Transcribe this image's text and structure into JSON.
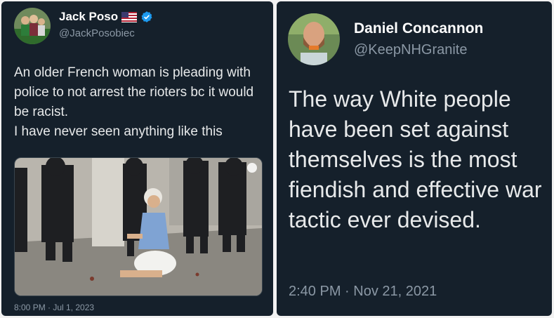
{
  "left_tweet": {
    "display_name": "Jack Poso",
    "handle": "@JackPosobiec",
    "text_lines": [
      "An older French woman is pleading with police to not arrest the rioters bc it would be racist.",
      "I have never seen anything like this"
    ],
    "timestamp": "8:00 PM · Jul 1, 2023",
    "icons": [
      "us-flag-icon",
      "verified-badge-icon"
    ],
    "colors": {
      "verified": "#1d9bf0"
    }
  },
  "right_tweet": {
    "display_name": "Daniel Concannon",
    "handle": "@KeepNHGranite",
    "text": "The way White people have been set against themselves is the most fiendish and effective war tactic ever devised.",
    "timestamp": "2:40 PM · Nov 21, 2021"
  },
  "theme": {
    "card_background": "#15202b",
    "secondary_text": "#8b98a5",
    "page_background": "#f2f2f2"
  }
}
